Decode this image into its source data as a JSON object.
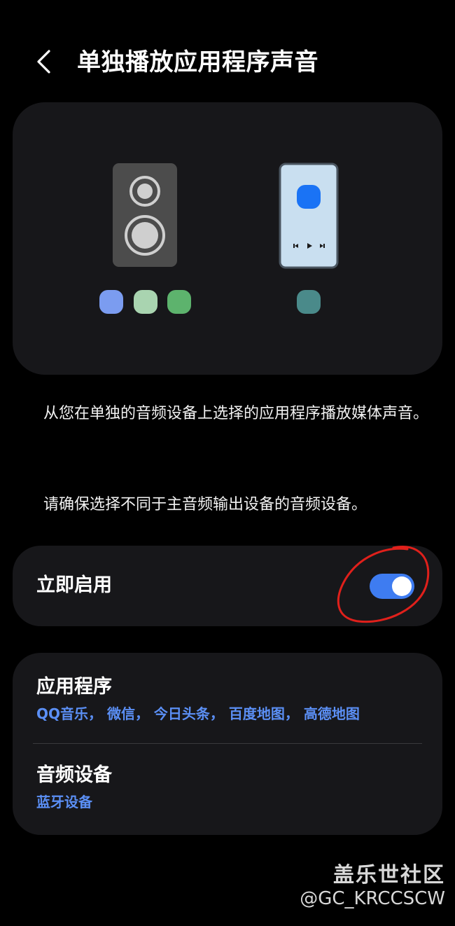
{
  "header": {
    "back_icon": "chevron-left-icon",
    "title": "单独播放应用程序声音"
  },
  "illustration": {
    "speaker_dot_colors": [
      "#7b9cf0",
      "#a9d4b0",
      "#5db36d"
    ],
    "phone_dot_color": "#4a8a8a",
    "accent_app_color": "#1a73f5"
  },
  "description": {
    "paragraph1": "从您在单独的音频设备上选择的应用程序播放媒体声音。",
    "paragraph2": "请确保选择不同于主音频输出设备的音频设备。"
  },
  "toggle": {
    "label": "立即启用",
    "state": "on",
    "accent": "#3e7cf1"
  },
  "settings": {
    "apps": {
      "title": "应用程序",
      "value": "QQ音乐， 微信， 今日头条， 百度地图， 高德地图"
    },
    "audio_device": {
      "title": "音频设备",
      "value": "蓝牙设备"
    }
  },
  "watermark": {
    "brand": "盖乐世社区",
    "handle": "@GC_KRCCSCW"
  }
}
